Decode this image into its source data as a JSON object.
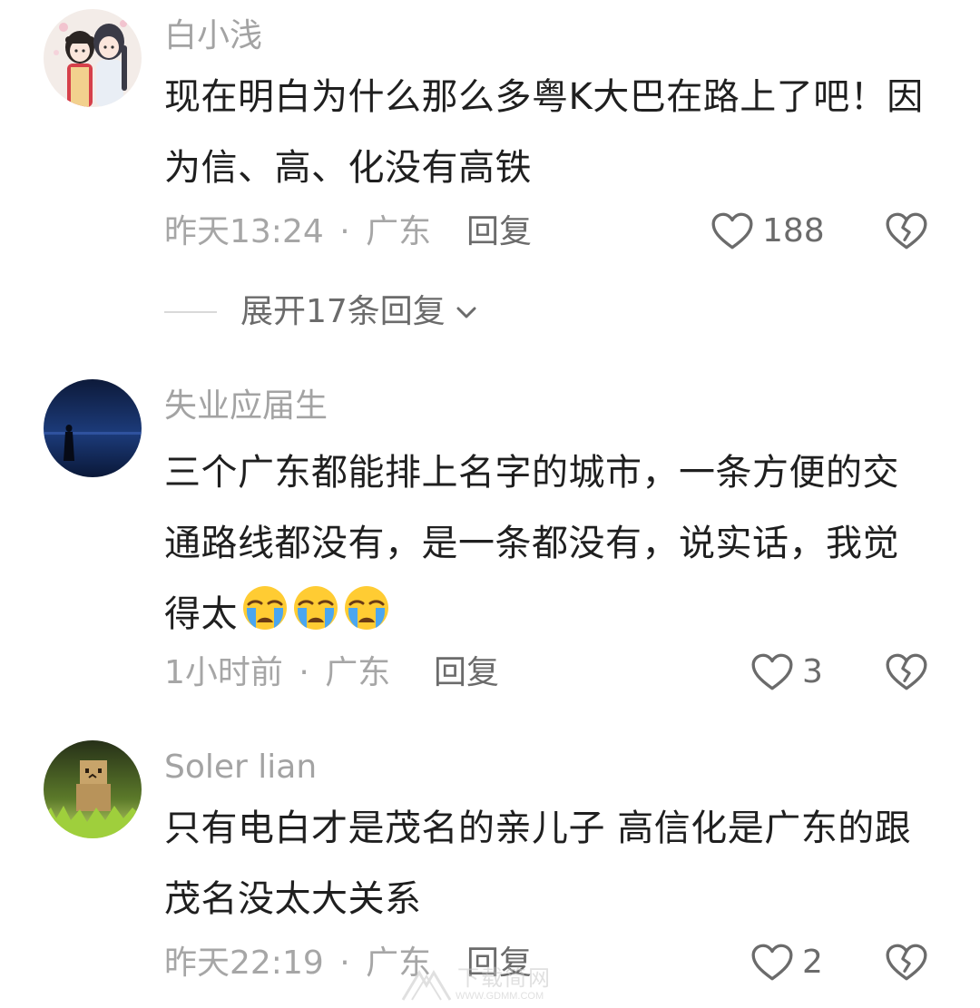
{
  "comments": [
    {
      "username": "白小浅",
      "body": "现在明白为什么那么多粤K大巴在路上了吧！因为信、高、化没有高铁",
      "time": "昨天13:24",
      "separator": "·",
      "location": "广东",
      "reply_label": "回复",
      "likes": "188",
      "expand_label": "展开17条回复",
      "avatar_icon": "anime-couple-avatar"
    },
    {
      "username": "失业应届生",
      "body": "三个广东都能排上名字的城市，一条方便的交通路线都没有，是一条都没有，说实话，我觉得太",
      "emojis": [
        "crying-face-emoji",
        "crying-face-emoji",
        "crying-face-emoji"
      ],
      "time": "1小时前",
      "separator": "·",
      "location": "广东",
      "reply_label": "回复",
      "likes": "3",
      "avatar_icon": "night-sea-figure-avatar"
    },
    {
      "username": "Soler lian",
      "body": "只有电白才是茂名的亲儿子 高信化是广东的跟茂名没太大关系",
      "time": "昨天22:19",
      "separator": "·",
      "location": "广东",
      "reply_label": "回复",
      "likes": "2",
      "avatar_icon": "cardboard-robot-grass-avatar"
    }
  ],
  "watermark": {
    "text": "下载简网",
    "url": "WWW.GDMM.COM"
  },
  "colors": {
    "username": "#a3a3a3",
    "body": "#1f1f1f",
    "meta": "#a6a6a6",
    "action": "#6b6b6b"
  }
}
